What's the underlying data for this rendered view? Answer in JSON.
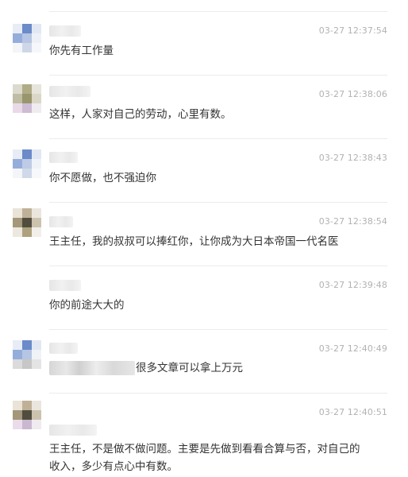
{
  "comments": [
    {
      "time": "03-27 12:37:54",
      "text": "你先有工作量"
    },
    {
      "time": "03-27 12:38:06",
      "text": "这样，人家对自己的劳动，心里有数。"
    },
    {
      "time": "03-27 12:38:43",
      "text": "你不愿做，也不强迫你"
    },
    {
      "time": "03-27 12:38:54",
      "text": "王主任，我的叔叔可以捧红你，让你成为大日本帝国一代名医"
    },
    {
      "time": "03-27 12:39:48",
      "text": "你的前途大大的"
    },
    {
      "time": "03-27 12:40:49",
      "text": "很多文章可以拿上万元"
    },
    {
      "time": "03-27 12:40:51",
      "text": "王主任，不是做不做问题。主要是先做到看看合算与否，对自己的收入，多少有点心中有数。"
    }
  ]
}
